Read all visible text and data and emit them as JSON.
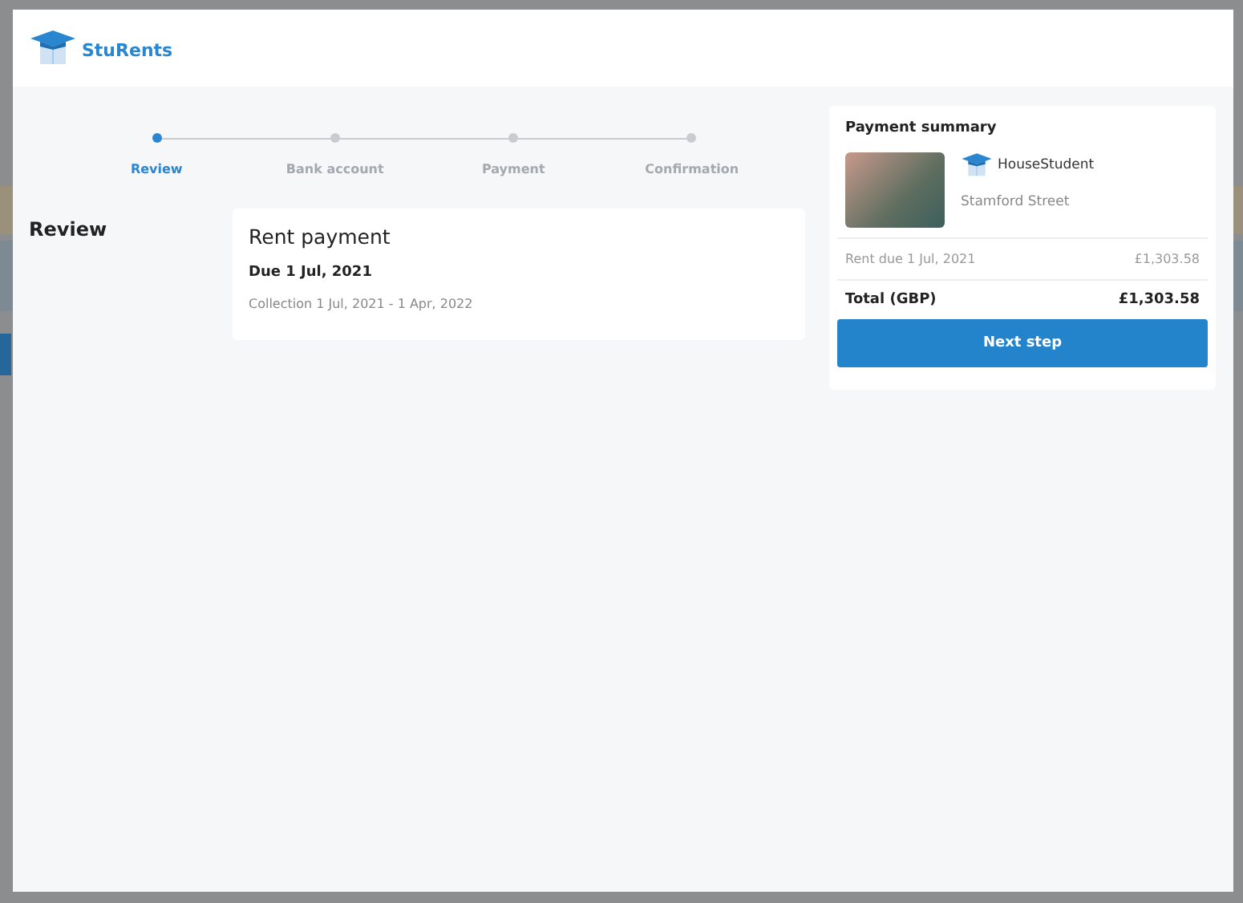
{
  "modal": {
    "brand": "StuRents",
    "steps": [
      {
        "label": "Review",
        "selected": true
      },
      {
        "label": "Bank account",
        "selected": false
      },
      {
        "label": "Payment",
        "selected": false
      },
      {
        "label": "Confirmation",
        "selected": false
      }
    ],
    "section_title": "Review",
    "rent_card": {
      "title": "Rent payment",
      "due": "Due 1 Jul, 2021",
      "collection": "Collection 1 Jul, 2021 - 1 Apr, 2022"
    },
    "summary": {
      "title": "Payment summary",
      "provider": "HouseStudent",
      "property": "Stamford Street",
      "lines": [
        {
          "label": "Rent due 1 Jul, 2021",
          "amount": "£1,303.58",
          "kind": "item"
        },
        {
          "label": "Total (GBP)",
          "amount": "£1,303.58",
          "kind": "total"
        }
      ],
      "button": "Next step"
    }
  }
}
